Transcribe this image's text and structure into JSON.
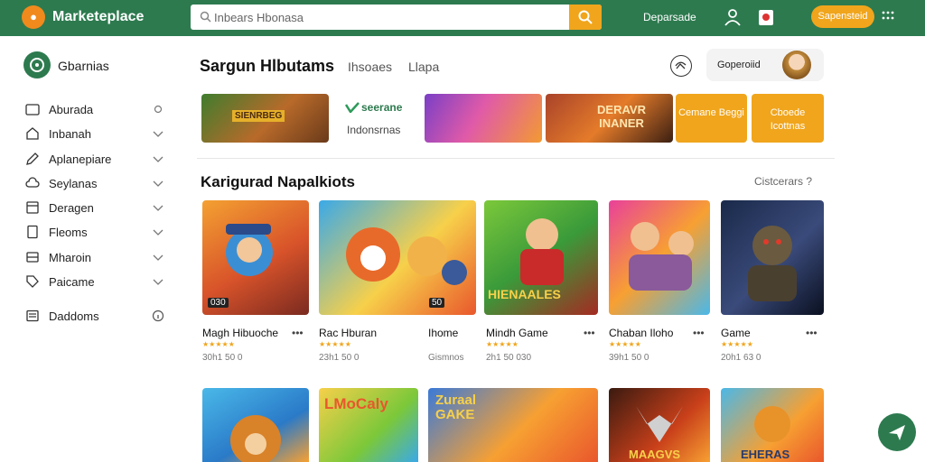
{
  "header": {
    "title": "Marketeplace",
    "search_value": "Inbears Hbonasa",
    "link": "Deparsade",
    "subscribe_label": "Sapensteid"
  },
  "sidebar": {
    "brand": "Gbarnias",
    "items": [
      {
        "label": "Aburada"
      },
      {
        "label": "Inbanah"
      },
      {
        "label": "Aplanepiare"
      },
      {
        "label": "Seylanas"
      },
      {
        "label": "Deragen"
      },
      {
        "label": "Fleoms"
      },
      {
        "label": "Mharoin"
      },
      {
        "label": "Paicame"
      },
      {
        "label": "Daddoms"
      }
    ]
  },
  "main": {
    "title": "Sargun Hlbutams",
    "tabs": [
      "Ihsoaes",
      "Llapa"
    ],
    "user": "Goperoiid"
  },
  "banners": {
    "game_banner_1": "SIENRBEG",
    "promo_brand": "seerane",
    "promo_sub": "Indonsrnas",
    "game_banner_2": "DERAVR INANER",
    "tile_1": "Cemane Beggi",
    "tile_2": "Cboede Icottnas"
  },
  "section": {
    "title": "Karigurad Napalkiots",
    "link": "Cistcerars ?"
  },
  "games": [
    {
      "name": "Magh Hibuoche",
      "stars": "★★★★★",
      "meta": "30h1 50 0",
      "badge": "030"
    },
    {
      "name": "Rac Hburan",
      "stars": "★★★★★",
      "meta": "23h1 50 0",
      "badge": "50"
    },
    {
      "name": "Ihome",
      "stars": "",
      "meta": "Gismnos"
    },
    {
      "name": "Mindh Game",
      "stars": "★★★★★",
      "meta": "2h1 50 030",
      "banner": "HIENAALES"
    },
    {
      "name": "Chaban Iloho",
      "stars": "★★★★★",
      "meta": "39h1 50 0"
    },
    {
      "name": "Game",
      "stars": "★★★★★",
      "meta": "20h1 63 0"
    }
  ],
  "row2": [
    {
      "text": ""
    },
    {
      "text": "LMoCaly"
    },
    {
      "text": "Zuraal GAKE"
    },
    {
      "text": "MAAGVS"
    },
    {
      "text": "EHERAS"
    }
  ],
  "colors": {
    "brand_green": "#2d7a4f",
    "accent_orange": "#f0a51c"
  }
}
